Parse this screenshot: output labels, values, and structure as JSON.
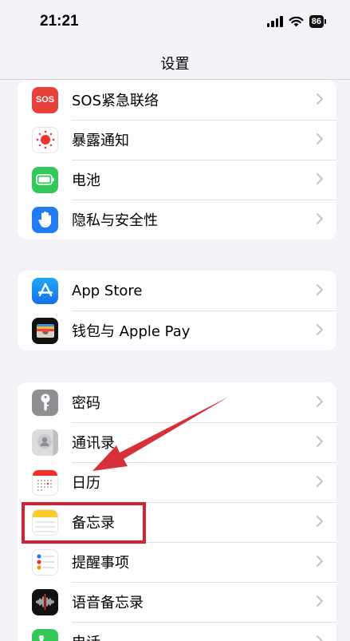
{
  "status": {
    "time": "21:21",
    "battery": "86"
  },
  "nav": {
    "title": "设置"
  },
  "groups": [
    {
      "items": [
        {
          "label": "SOS紧急联络",
          "icon": "sos-icon",
          "icon_text": "SOS",
          "color": "#e8403b"
        },
        {
          "label": "暴露通知",
          "icon": "exposure-notification-icon",
          "color": "#ffffff"
        },
        {
          "label": "电池",
          "icon": "battery-icon",
          "color": "#34c759"
        },
        {
          "label": "隐私与安全性",
          "icon": "hand-icon",
          "color": "#1f7cf3"
        }
      ]
    },
    {
      "items": [
        {
          "label": "App Store",
          "icon": "app-store-icon",
          "color": "#1b8cf3"
        },
        {
          "label": "钱包与 Apple Pay",
          "icon": "wallet-icon",
          "color": "#111111"
        }
      ]
    },
    {
      "items": [
        {
          "label": "密码",
          "icon": "key-icon",
          "color": "#8e8e93"
        },
        {
          "label": "通讯录",
          "icon": "contacts-icon",
          "color": "#d1d1d6"
        },
        {
          "label": "日历",
          "icon": "calendar-icon",
          "color": "#ffffff"
        },
        {
          "label": "备忘录",
          "icon": "notes-icon",
          "color": "#ffffff"
        },
        {
          "label": "提醒事项",
          "icon": "reminders-icon",
          "color": "#ffffff"
        },
        {
          "label": "语音备忘录",
          "icon": "voice-memos-icon",
          "color": "#111111"
        },
        {
          "label": "电话",
          "icon": "phone-icon",
          "color": "#34c759"
        }
      ]
    }
  ],
  "annotation": {
    "color": "#d32233"
  }
}
